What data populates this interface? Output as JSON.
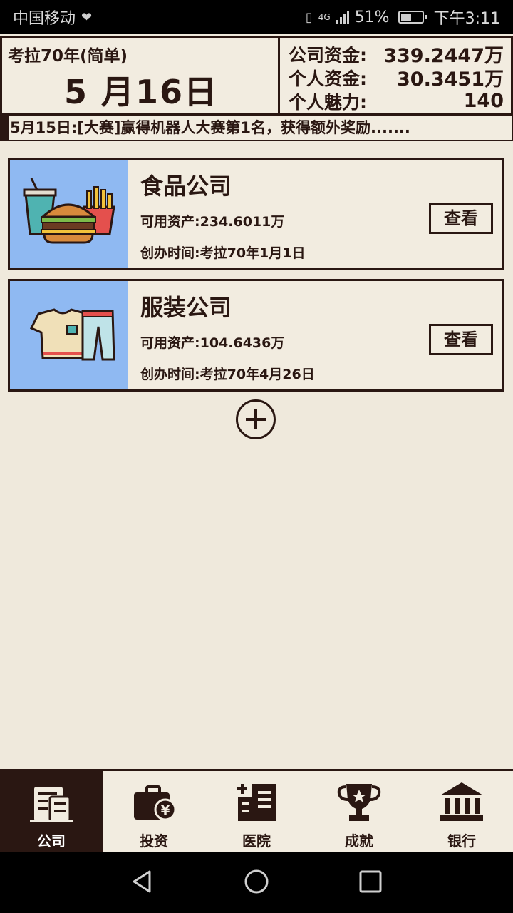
{
  "status_bar": {
    "carrier": "中国移动",
    "network": "4G",
    "battery_percent": "51%",
    "battery_level": 0.51,
    "time": "下午3:11"
  },
  "header": {
    "game_mode": "考拉70年(简单)",
    "date": "5 月16日",
    "stats": [
      {
        "label": "公司资金:",
        "value": "339.2447万"
      },
      {
        "label": "个人资金:",
        "value": "30.3451万"
      },
      {
        "label": "个人魅力:",
        "value": "140"
      }
    ]
  },
  "ticker": {
    "text": "5月15日:[大赛]赢得机器人大赛第1名，获得额外奖励......."
  },
  "companies": [
    {
      "name": "食品公司",
      "assets": "可用资产:234.6011万",
      "founded": "创办时间:考拉70年1月1日",
      "button": "查看",
      "icon": "burger-fries-icon"
    },
    {
      "name": "服装公司",
      "assets": "可用资产:104.6436万",
      "founded": "创办时间:考拉70年4月26日",
      "button": "查看",
      "icon": "clothes-icon"
    }
  ],
  "tabs": [
    {
      "label": "公司",
      "icon": "building-icon",
      "active": true
    },
    {
      "label": "投资",
      "icon": "briefcase-yen-icon",
      "active": false
    },
    {
      "label": "医院",
      "icon": "hospital-icon",
      "active": false
    },
    {
      "label": "成就",
      "icon": "trophy-icon",
      "active": false
    },
    {
      "label": "银行",
      "icon": "bank-icon",
      "active": false
    }
  ],
  "colors": {
    "background": "#efe9dc",
    "ink": "#2a1712",
    "card_image_bg": "#8fb9f2"
  }
}
